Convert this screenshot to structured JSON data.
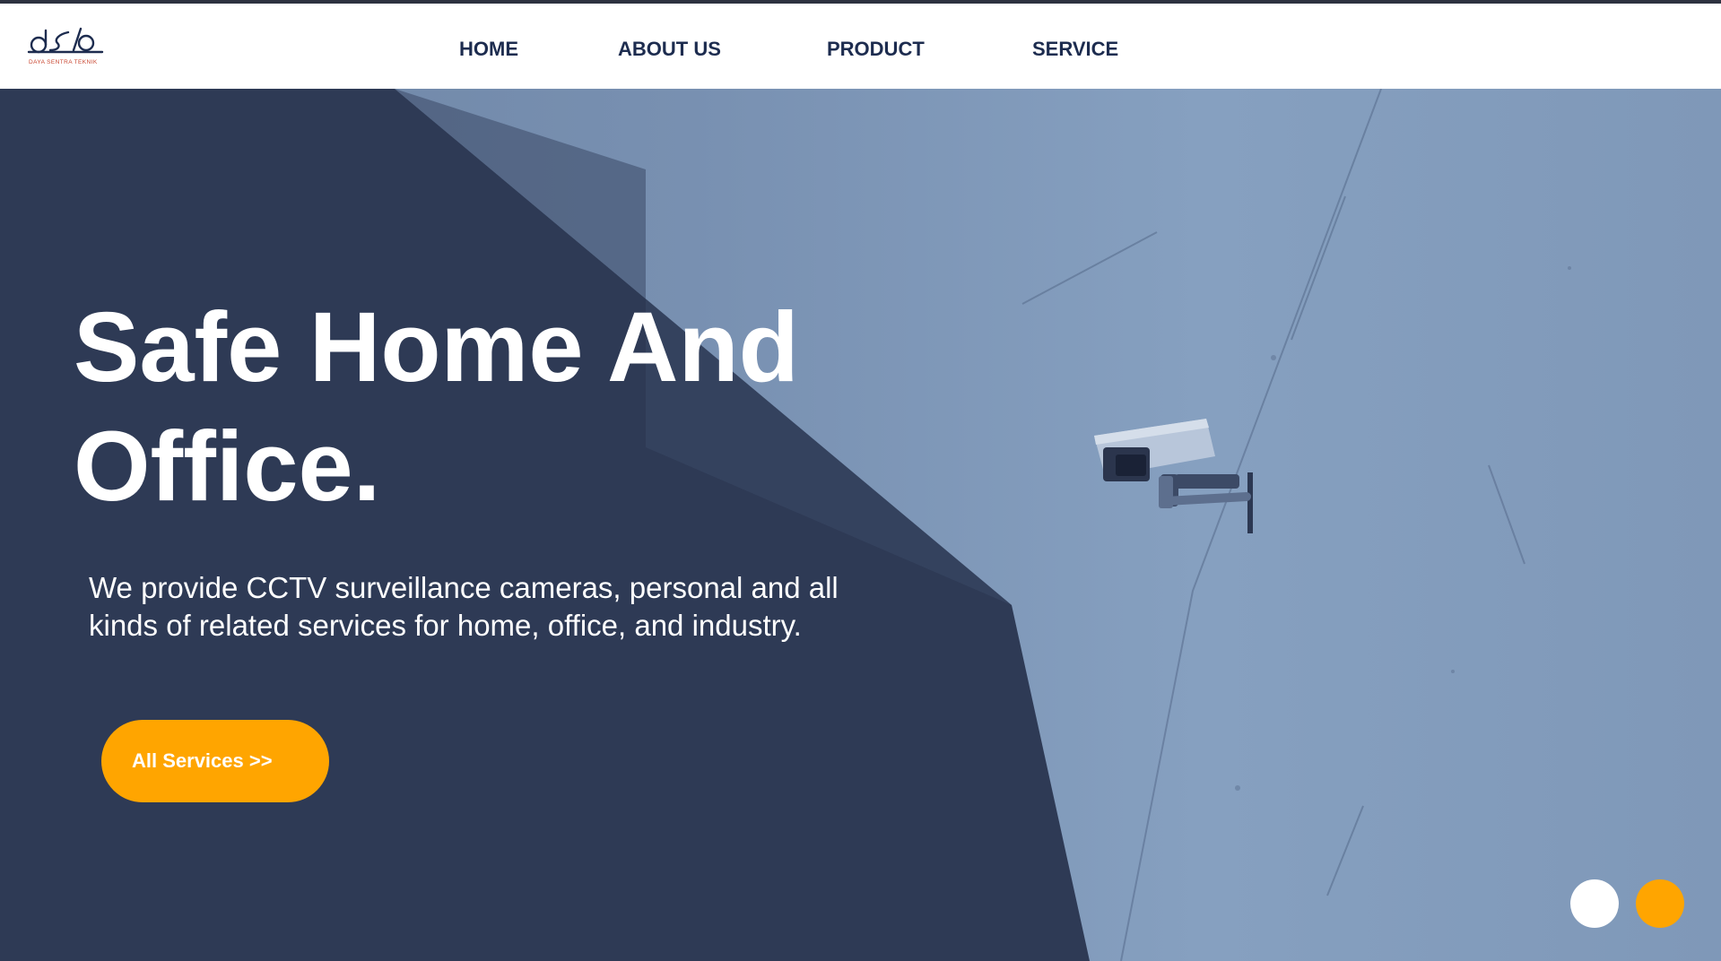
{
  "brand": {
    "logo_mark": "dst",
    "logo_tagline": "DAYA SENTRA TEKNIK"
  },
  "nav": {
    "items": [
      {
        "label": "HOME"
      },
      {
        "label": "ABOUT US"
      },
      {
        "label": "PRODUCT"
      },
      {
        "label": "SERVICE"
      }
    ]
  },
  "hero": {
    "title_line1": "Safe Home And",
    "title_line2": "Office.",
    "description": "We provide CCTV surveillance cameras, personal and all kinds of related services for home, office, and industry.",
    "cta_label": "All Services >>",
    "image_subject": "cctv-camera-on-wall"
  },
  "slider": {
    "total": 2,
    "active_index": 1
  },
  "colors": {
    "navy": "#1d2c4f",
    "accent": "#ffa500",
    "logo_red": "#c8452f",
    "hero_dark": "#2e3a55",
    "hero_wall": "#7f98b8"
  }
}
